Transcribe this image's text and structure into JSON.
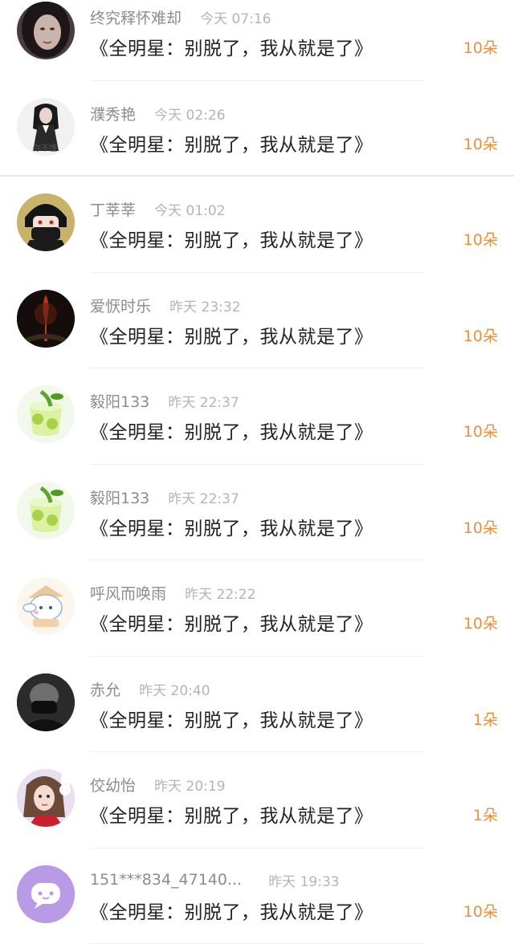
{
  "entries": [
    {
      "name": "终究释怀难却",
      "time": "今天 07:16",
      "gift": "《全明星：别脱了，我从就是了》",
      "count": "10朵",
      "avatar": "dark-haired-woman",
      "time_gap": 18
    },
    {
      "name": "濮秀艳",
      "time": "今天 02:26",
      "gift": "《全明星：别脱了，我从就是了》",
      "count": "10朵",
      "avatar": "girl-in-dress",
      "time_gap": 18
    },
    {
      "name": "丁莘莘",
      "time": "今天 01:02",
      "gift": "《全明星：别脱了，我从就是了》",
      "count": "10朵",
      "avatar": "anime-boy-masked",
      "time_gap": 18
    },
    {
      "name": "爱恹时乐",
      "time": "昨天 23:32",
      "gift": "《全明星：别脱了，我从就是了》",
      "count": "10朵",
      "avatar": "dark-fire-art",
      "time_gap": 18
    },
    {
      "name": "毅阳133",
      "time": "昨天 22:37",
      "gift": "《全明星：别脱了，我从就是了》",
      "count": "10朵",
      "avatar": "mojito-drink",
      "time_gap": 18
    },
    {
      "name": "毅阳133",
      "time": "昨天 22:37",
      "gift": "《全明星：别脱了，我从就是了》",
      "count": "10朵",
      "avatar": "mojito-drink",
      "time_gap": 18
    },
    {
      "name": "呼风而唤雨",
      "time": "昨天 22:22",
      "gift": "《全明星：别脱了，我从就是了》",
      "count": "10朵",
      "avatar": "cinnamoroll-cartoon",
      "time_gap": 18
    },
    {
      "name": "赤允",
      "time": "昨天 20:40",
      "gift": "《全明星：别脱了，我从就是了》",
      "count": "1朵",
      "avatar": "person-in-black-mask",
      "time_gap": 18
    },
    {
      "name": "佼幼怡",
      "time": "昨天 20:19",
      "gift": "《全明星：别脱了，我从就是了》",
      "count": "1朵",
      "avatar": "girl-with-bunny",
      "time_gap": 18
    },
    {
      "name": "151***834_47140...",
      "time": "昨天 19:33",
      "gift": "《全明星：别脱了，我从就是了》",
      "count": "10朵",
      "avatar": "purple-chat-bubble",
      "time_gap": 28
    }
  ]
}
